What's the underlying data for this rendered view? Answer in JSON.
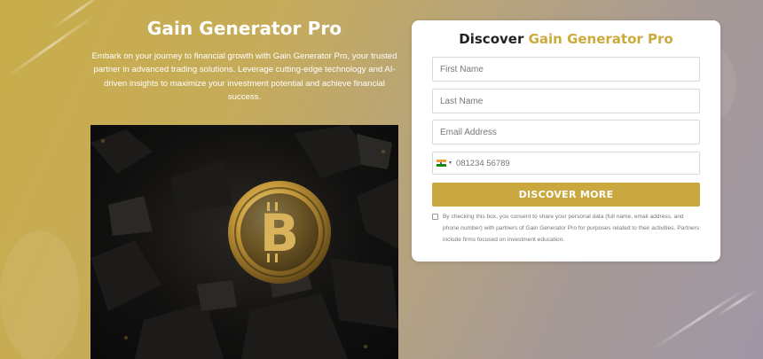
{
  "hero": {
    "title": "Gain Generator Pro",
    "description": "Embark on your journey to financial growth with Gain Generator Pro, your trusted partner in advanced trading solutions. Leverage cutting-edge technology and AI-driven insights to maximize your investment potential and achieve financial success."
  },
  "signup_form": {
    "title_prefix": "Discover",
    "title_brand": "Gain Generator Pro",
    "first_name_placeholder": "First Name",
    "last_name_placeholder": "Last Name",
    "email_placeholder": "Email Address",
    "phone_country_icon": "india-flag-icon",
    "phone_placeholder": "081234 56789",
    "submit_label": "DISCOVER MORE",
    "consent_text": "By checking this box, you consent to share your personal data (full name, email address, and phone number) with partners of Gain Generator Pro for purposes related to their activities. Partners include firms focused on investment education."
  },
  "colors": {
    "accent": "#c9a83f",
    "background_start": "#c9ad4a",
    "background_end": "#9f97a6"
  }
}
